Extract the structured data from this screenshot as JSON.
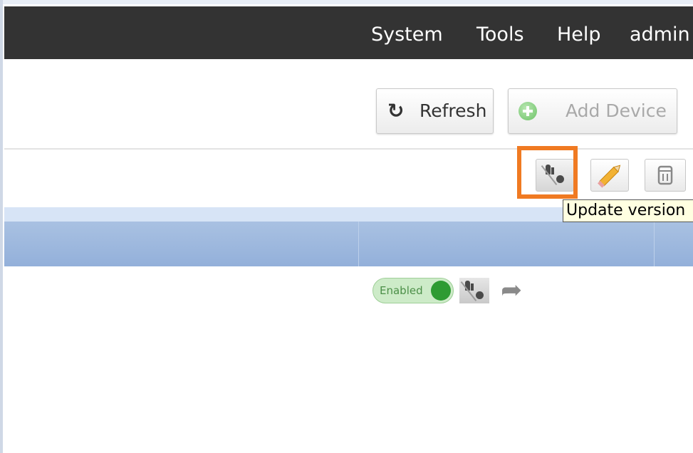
{
  "topbar": {
    "menus": [
      "System",
      "Tools",
      "Help",
      "admin"
    ]
  },
  "actions": {
    "refresh_label": "Refresh",
    "add_device_label": "Add Device",
    "refresh_icon": "refresh-icon",
    "add_device_icon": "plus-circle-icon"
  },
  "toolbar": {
    "update_version_icon": "plug-icon",
    "edit_icon": "pencil-icon",
    "delete_icon": "trash-icon",
    "tooltip": "Update version",
    "highlight_color": "#f07a22"
  },
  "row": {
    "status_label": "Enabled",
    "status_color": "#2e9b32",
    "arrow_icon": "redo-arrow-icon"
  }
}
